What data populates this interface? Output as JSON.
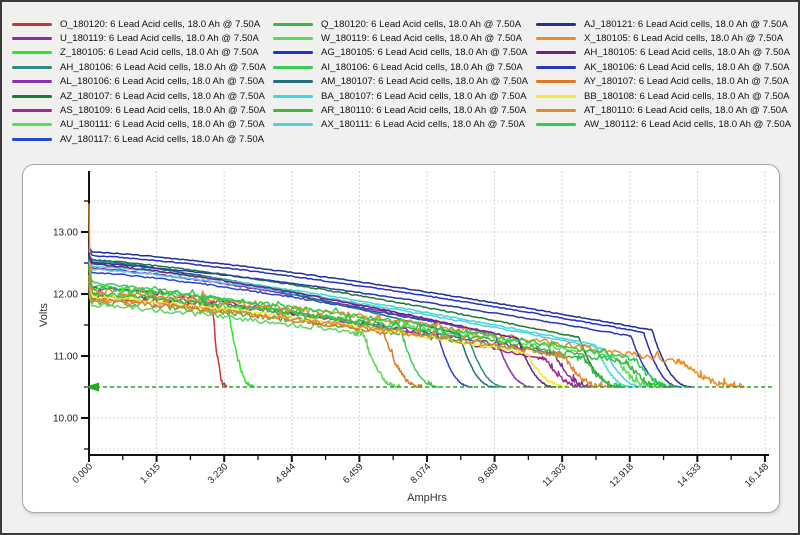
{
  "window": {
    "background": "#f0f0ee",
    "border_color": "#3a3a3a"
  },
  "chart_data": {
    "type": "line",
    "title": "",
    "xlabel": "AmpHrs",
    "ylabel": "Volts",
    "xlim": [
      0,
      16.148
    ],
    "ylim": [
      9.4,
      14.0
    ],
    "x_major_ticks": [
      0,
      1.6148,
      3.2296,
      4.8444,
      6.4592,
      8.074,
      9.6888,
      11.3036,
      12.9184,
      14.5332,
      16.148
    ],
    "x_tick_labels": [
      "0.000",
      "1.615",
      "3.230",
      "4.844",
      "6.459",
      "8.074",
      "9.689",
      "11.303",
      "12.918",
      "14.533",
      "16.148"
    ],
    "x_minor_tick_interval": 0.8074,
    "y_major_ticks": [
      13,
      12,
      11,
      10
    ],
    "y_tick_labels": [
      "13.00",
      "12.00",
      "11.00",
      "10.00"
    ],
    "y_minor_ticks": [
      13.5,
      12.5,
      11.5,
      10.5,
      9.5
    ],
    "grid": true,
    "grid_color_major": "#d2d2d2",
    "grid_color_minor": "#e3e3e3",
    "axis_color": "#111111",
    "cutoff_line": {
      "volts": 10.5,
      "color": "#22aa22",
      "style": "dashed",
      "arrow": "left"
    },
    "legend_position": "top",
    "legend_column_counts": [
      9,
      8,
      8
    ],
    "series": [
      {
        "id": "O_180120",
        "label": "O_180120: 6 Lead Acid cells, 18.0 Ah @ 7.50A",
        "color": "#cc3333",
        "start_v": 12.3,
        "plateau_v": 11.95,
        "knee_v": 11.82,
        "knee_ah": 2.95,
        "end_ah": 3.28,
        "end_v": 10.5,
        "noise": 0.05,
        "noisy": true
      },
      {
        "id": "U_180119",
        "label": "U_180119: 6 Lead Acid cells, 18.0 Ah @ 7.50A",
        "color": "#8b2f9b",
        "start_v": 12.45,
        "plateau_v": 12.0,
        "knee_v": 11.05,
        "knee_ah": 11.1,
        "end_ah": 12.05,
        "end_v": 10.5,
        "noise": 0.035,
        "noisy": true
      },
      {
        "id": "Z_180105",
        "label": "Z_180105: 6 Lead Acid cells, 18.0 Ah @ 7.50A",
        "color": "#2ee52e",
        "start_v": 12.5,
        "plateau_v": 12.12,
        "knee_v": 11.9,
        "knee_ah": 3.3,
        "end_ah": 3.95,
        "end_v": 10.5,
        "noise": 0.03,
        "noisy": true
      },
      {
        "id": "AH_180106",
        "label": "AH_180106: 6 Lead Acid cells, 18.0 Ah @ 7.50A",
        "color": "#2e8b85",
        "start_v": 12.7,
        "plateau_v": 12.52,
        "knee_v": 11.45,
        "knee_ah": 9.0,
        "end_ah": 9.95,
        "end_v": 10.5,
        "noise": 0.01,
        "noisy": false
      },
      {
        "id": "AL_180106",
        "label": "AL_180106: 6 Lead Acid cells, 18.0 Ah @ 7.50A",
        "color": "#8833aa",
        "start_v": 12.65,
        "plateau_v": 12.42,
        "knee_v": 11.35,
        "knee_ah": 9.7,
        "end_ah": 10.6,
        "end_v": 10.5,
        "noise": 0.012,
        "noisy": false
      },
      {
        "id": "AZ_180107",
        "label": "AZ_180107: 6 Lead Acid cells, 18.0 Ah @ 7.50A",
        "color": "#1e7a32",
        "start_v": 12.72,
        "plateau_v": 12.55,
        "knee_v": 11.3,
        "knee_ah": 11.7,
        "end_ah": 12.7,
        "end_v": 10.5,
        "noise": 0.01,
        "noisy": false
      },
      {
        "id": "AS_180109",
        "label": "AS_180109: 6 Lead Acid cells, 18.0 Ah @ 7.50A",
        "color": "#9a2b8f",
        "start_v": 12.4,
        "plateau_v": 12.1,
        "knee_v": 10.95,
        "knee_ah": 10.9,
        "end_ah": 11.85,
        "end_v": 10.5,
        "noise": 0.03,
        "noisy": true
      },
      {
        "id": "AU_180111",
        "label": "AU_180111: 6 Lead Acid cells, 18.0 Ah @ 7.50A",
        "color": "#55e055",
        "start_v": 12.3,
        "plateau_v": 11.98,
        "knee_v": 11.0,
        "knee_ah": 12.55,
        "end_ah": 13.55,
        "end_v": 10.5,
        "noise": 0.05,
        "noisy": true
      },
      {
        "id": "AV_180117",
        "label": "AV_180117: 6 Lead Acid cells, 18.0 Ah @ 7.50A",
        "color": "#2947d0",
        "start_v": 12.55,
        "plateau_v": 12.35,
        "knee_v": 11.55,
        "knee_ah": 8.25,
        "end_ah": 9.15,
        "end_v": 10.5,
        "noise": 0.012,
        "noisy": false
      },
      {
        "id": "Q_180120",
        "label": "Q_180120: 6 Lead Acid cells, 18.0 Ah @ 7.50A",
        "color": "#3cb54a",
        "start_v": 12.2,
        "plateau_v": 11.88,
        "knee_v": 10.95,
        "knee_ah": 11.85,
        "end_ah": 12.8,
        "end_v": 10.5,
        "noise": 0.05,
        "noisy": true
      },
      {
        "id": "W_180119",
        "label": "W_180119: 6 Lead Acid cells, 18.0 Ah @ 7.50A",
        "color": "#5fd45f",
        "start_v": 12.15,
        "plateau_v": 11.82,
        "knee_v": 11.35,
        "knee_ah": 6.55,
        "end_ah": 7.45,
        "end_v": 10.5,
        "noise": 0.04,
        "noisy": true
      },
      {
        "id": "AG_180105",
        "label": "AG_180105: 6 Lead Acid cells, 18.0 Ah @ 7.50A",
        "color": "#2531cc",
        "start_v": 12.75,
        "plateau_v": 12.62,
        "knee_v": 11.38,
        "knee_ah": 13.25,
        "end_ah": 14.15,
        "end_v": 10.5,
        "noise": 0.008,
        "noisy": false
      },
      {
        "id": "AI_180106",
        "label": "AI_180106: 6 Lead Acid cells, 18.0 Ah @ 7.50A",
        "color": "#3fca57",
        "start_v": 12.4,
        "plateau_v": 12.18,
        "knee_v": 11.4,
        "knee_ah": 7.45,
        "end_ah": 8.35,
        "end_v": 10.5,
        "noise": 0.025,
        "noisy": true
      },
      {
        "id": "AM_180107",
        "label": "AM_180107: 6 Lead Acid cells, 18.0 Ah @ 7.50A",
        "color": "#1f6f7f",
        "start_v": 12.7,
        "plateau_v": 12.55,
        "knee_v": 11.35,
        "knee_ah": 8.85,
        "end_ah": 9.7,
        "end_v": 10.5,
        "noise": 0.008,
        "noisy": false
      },
      {
        "id": "BA_180107",
        "label": "BA_180107: 6 Lead Acid cells, 18.0 Ah @ 7.50A",
        "color": "#3fd9d9",
        "start_v": 12.6,
        "plateau_v": 12.45,
        "knee_v": 11.18,
        "knee_ah": 12.1,
        "end_ah": 13.0,
        "end_v": 10.5,
        "noise": 0.01,
        "noisy": false
      },
      {
        "id": "AR_180110",
        "label": "AR_180110: 6 Lead Acid cells, 18.0 Ah @ 7.50A",
        "color": "#3db83d",
        "start_v": 12.3,
        "plateau_v": 12.0,
        "knee_v": 10.9,
        "knee_ah": 12.85,
        "end_ah": 13.8,
        "end_v": 10.5,
        "noise": 0.045,
        "noisy": true
      },
      {
        "id": "AX_180111",
        "label": "AX_180111: 6 Lead Acid cells, 18.0 Ah @ 7.50A",
        "color": "#55cce8",
        "start_v": 12.55,
        "plateau_v": 12.4,
        "knee_v": 11.12,
        "knee_ah": 12.3,
        "end_ah": 13.3,
        "end_v": 10.5,
        "noise": 0.012,
        "noisy": false
      },
      {
        "id": "AJ_180121",
        "label": "AJ_180121: 6 Lead Acid cells, 18.0 Ah @ 7.50A",
        "color": "#222f96",
        "start_v": 12.8,
        "plateau_v": 12.68,
        "knee_v": 11.42,
        "knee_ah": 13.45,
        "end_ah": 14.4,
        "end_v": 10.5,
        "noise": 0.008,
        "noisy": false
      },
      {
        "id": "X_180105",
        "label": "X_180105: 6 Lead Acid cells, 18.0 Ah @ 7.50A",
        "color": "#f08a22",
        "start_v": 13.45,
        "plateau_v": 12.05,
        "knee_v": 10.9,
        "knee_ah": 14.2,
        "end_ah": 15.65,
        "end_v": 10.5,
        "noise": 0.045,
        "noisy": true
      },
      {
        "id": "AH_180105",
        "label": "AH_180105: 6 Lead Acid cells, 18.0 Ah @ 7.50A",
        "color": "#6f2282",
        "start_v": 12.65,
        "plateau_v": 12.48,
        "knee_v": 11.28,
        "knee_ah": 10.25,
        "end_ah": 11.15,
        "end_v": 10.5,
        "noise": 0.012,
        "noisy": false
      },
      {
        "id": "AK_180106",
        "label": "AK_180106: 6 Lead Acid cells, 18.0 Ah @ 7.50A",
        "color": "#2838b0",
        "start_v": 12.65,
        "plateau_v": 12.5,
        "knee_v": 11.32,
        "knee_ah": 12.95,
        "end_ah": 13.9,
        "end_v": 10.5,
        "noise": 0.008,
        "noisy": false
      },
      {
        "id": "AY_180107",
        "label": "AY_180107: 6 Lead Acid cells, 18.0 Ah @ 7.50A",
        "color": "#e07722",
        "start_v": 12.3,
        "plateau_v": 11.92,
        "knee_v": 11.38,
        "knee_ah": 7.05,
        "end_ah": 7.95,
        "end_v": 10.5,
        "noise": 0.04,
        "noisy": true
      },
      {
        "id": "BB_180108",
        "label": "BB_180108: 6 Lead Acid cells, 18.0 Ah @ 7.50A",
        "color": "#ecec3f",
        "start_v": 12.2,
        "plateau_v": 11.95,
        "knee_v": 11.05,
        "knee_ah": 10.45,
        "end_ah": 11.45,
        "end_v": 10.5,
        "noise": 0.03,
        "noisy": true
      },
      {
        "id": "AT_180110",
        "label": "AT_180110: 6 Lead Acid cells, 18.0 Ah @ 7.50A",
        "color": "#e08a33",
        "start_v": 12.25,
        "plateau_v": 11.9,
        "knee_v": 11.0,
        "knee_ah": 11.35,
        "end_ah": 12.35,
        "end_v": 10.5,
        "noise": 0.045,
        "noisy": true
      },
      {
        "id": "AW_180112",
        "label": "AW_180112: 6 Lead Acid cells, 18.0 Ah @ 7.50A",
        "color": "#2ecc4e",
        "start_v": 12.45,
        "plateau_v": 12.1,
        "knee_v": 10.95,
        "knee_ah": 13.05,
        "end_ah": 14.0,
        "end_v": 10.5,
        "noise": 0.04,
        "noisy": true
      }
    ]
  }
}
